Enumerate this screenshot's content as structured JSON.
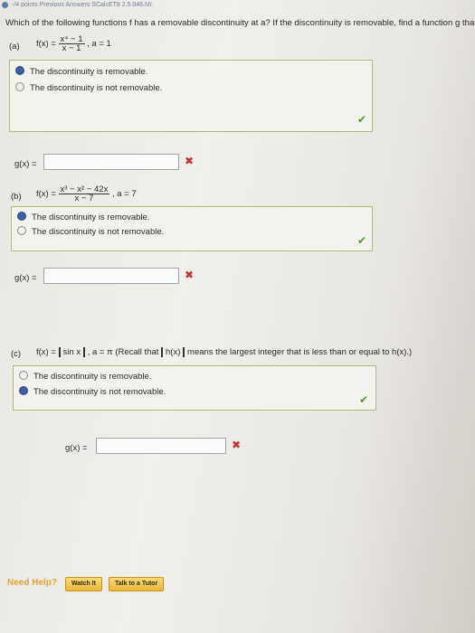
{
  "header": {
    "text": "-/4 points | PreviousAnswers  SCalcET8 2.5.046.MI.",
    "text_short": "-/4 points   Previous Answers   SCalcET8 2.5.046.MI."
  },
  "question": {
    "text": "Which of the following functions f has a removable discontinuity at a? If the discontinuity is removable, find a function g that agrees with"
  },
  "parts": [
    {
      "label": "(a)",
      "function": "f(x) = ",
      "numerator": "x⁴ − 1",
      "denominator": "x − 1",
      "point": ",    a = 1",
      "options": [
        "The discontinuity is removable.",
        "The discontinuity is not removable."
      ],
      "selected_index": 0,
      "g_label": "g(x) =",
      "g_value": ""
    },
    {
      "label": "(b)",
      "function": "f(x) = ",
      "numerator": "x³ − x² − 42x",
      "denominator": "x − 7",
      "point": ",    a = 7",
      "options": [
        "The discontinuity is removable.",
        "The discontinuity is not removable."
      ],
      "selected_index": 0,
      "g_label": "g(x) =",
      "g_value": ""
    },
    {
      "label": "(c)",
      "function": "f(x) = ",
      "inner": "sin x",
      "point": ",    a = π  (Recall that",
      "recall_inner": "h(x)",
      "recall_rest": "means the largest integer that is less than or equal to h(x).)",
      "options": [
        "The discontinuity is removable.",
        "The discontinuity is not removable."
      ],
      "selected_index": 1,
      "g_label": "g(x) =",
      "g_value": ""
    }
  ],
  "footer": {
    "need_help": "Need Help?",
    "watch_it": "Watch It",
    "talk_tutor": "Talk to a Tutor"
  },
  "colors": {
    "correct": "#4a9a2a",
    "incorrect": "#c8302e",
    "selected_radio": "#3b5fa0",
    "button": "#f2c14e"
  }
}
